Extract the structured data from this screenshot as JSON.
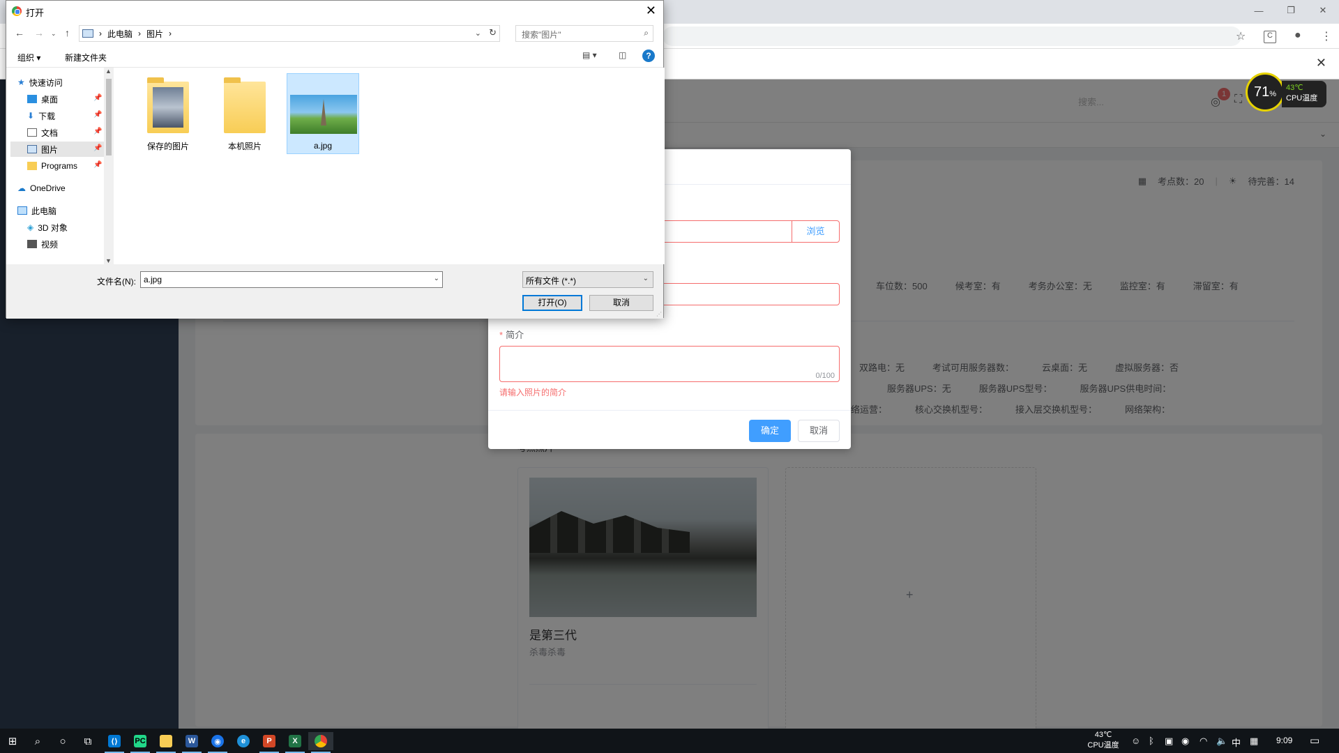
{
  "browser": {
    "controls": {
      "minimize": "—",
      "restore": "❐",
      "close": "✕"
    },
    "icons": [
      "star-icon",
      "extension-icon",
      "account-icon",
      "menu-icon"
    ]
  },
  "app": {
    "header": {
      "search_placeholder": "搜索...",
      "badge_count": "1"
    },
    "stats": {
      "points_label": "考点数：20",
      "pending_label": "待完善：14"
    },
    "info_row1": [
      "车位数：500",
      "候考室：有",
      "考务办公室：无",
      "监控室：有",
      "滞留室：有"
    ],
    "info_row2": [
      "双路电：无",
      "考试可用服务器数：",
      "云桌面：无",
      "虚拟服务器：否"
    ],
    "info_row3": [
      "服务器UPS：无",
      "服务器UPS型号：",
      "服务器UPS供电时间："
    ],
    "info_row4": [
      "络运营：",
      "核心交换机型号：",
      "接入层交换机型号：",
      "网络架构："
    ],
    "photo_section": {
      "title": "考点照片",
      "card": {
        "title": "是第三代",
        "subtitle": "杀毒杀毒"
      },
      "add_symbol": "+"
    }
  },
  "upload_dialog": {
    "browse_label": "浏览",
    "intro_label": "简介",
    "required_mark": "*",
    "counter": "0/100",
    "error": "请输入照片的简介",
    "ok_label": "确定",
    "cancel_label": "取消"
  },
  "cpu_widget": {
    "usage": "71",
    "unit": "%",
    "temp": "43℃",
    "label": "CPU温度"
  },
  "file_dialog": {
    "title": "打开",
    "breadcrumb": [
      "此电脑",
      "图片"
    ],
    "search_placeholder": "搜索\"图片\"",
    "toolbar": {
      "organize": "组织 ▾",
      "new_folder": "新建文件夹"
    },
    "nav": [
      {
        "label": "快速访问",
        "icon": "star-icon"
      },
      {
        "label": "桌面",
        "icon": "desktop-icon",
        "pinned": true
      },
      {
        "label": "下载",
        "icon": "download-icon",
        "pinned": true
      },
      {
        "label": "文档",
        "icon": "document-icon",
        "pinned": true
      },
      {
        "label": "图片",
        "icon": "pictures-icon",
        "pinned": true,
        "selected": true
      },
      {
        "label": "Programs",
        "icon": "folder-icon",
        "pinned": true
      },
      {
        "label": "OneDrive",
        "icon": "cloud-icon"
      },
      {
        "label": "此电脑",
        "icon": "computer-icon"
      },
      {
        "label": "3D 对象",
        "icon": "cube-icon"
      },
      {
        "label": "视频",
        "icon": "video-icon"
      }
    ],
    "files": [
      {
        "name": "保存的图片",
        "type": "folder"
      },
      {
        "name": "本机照片",
        "type": "folder"
      },
      {
        "name": "a.jpg",
        "type": "image",
        "selected": true
      }
    ],
    "filename_label": "文件名(N):",
    "filename_value": "a.jpg",
    "filetype_value": "所有文件 (*.*)",
    "open_label": "打开(O)",
    "cancel_label": "取消"
  },
  "taskbar": {
    "apps": [
      "start-icon",
      "search-icon",
      "cortana-icon",
      "task-view-icon",
      "vscode-icon",
      "pycharm-icon",
      "file-explorer-icon",
      "word-icon",
      "browser-icon",
      "edge-icon",
      "powerpoint-icon",
      "excel-icon",
      "chrome-icon"
    ],
    "tray_temp": "43℃",
    "tray_temp_label": "CPU温度",
    "ime": "中",
    "time": "9:09"
  }
}
